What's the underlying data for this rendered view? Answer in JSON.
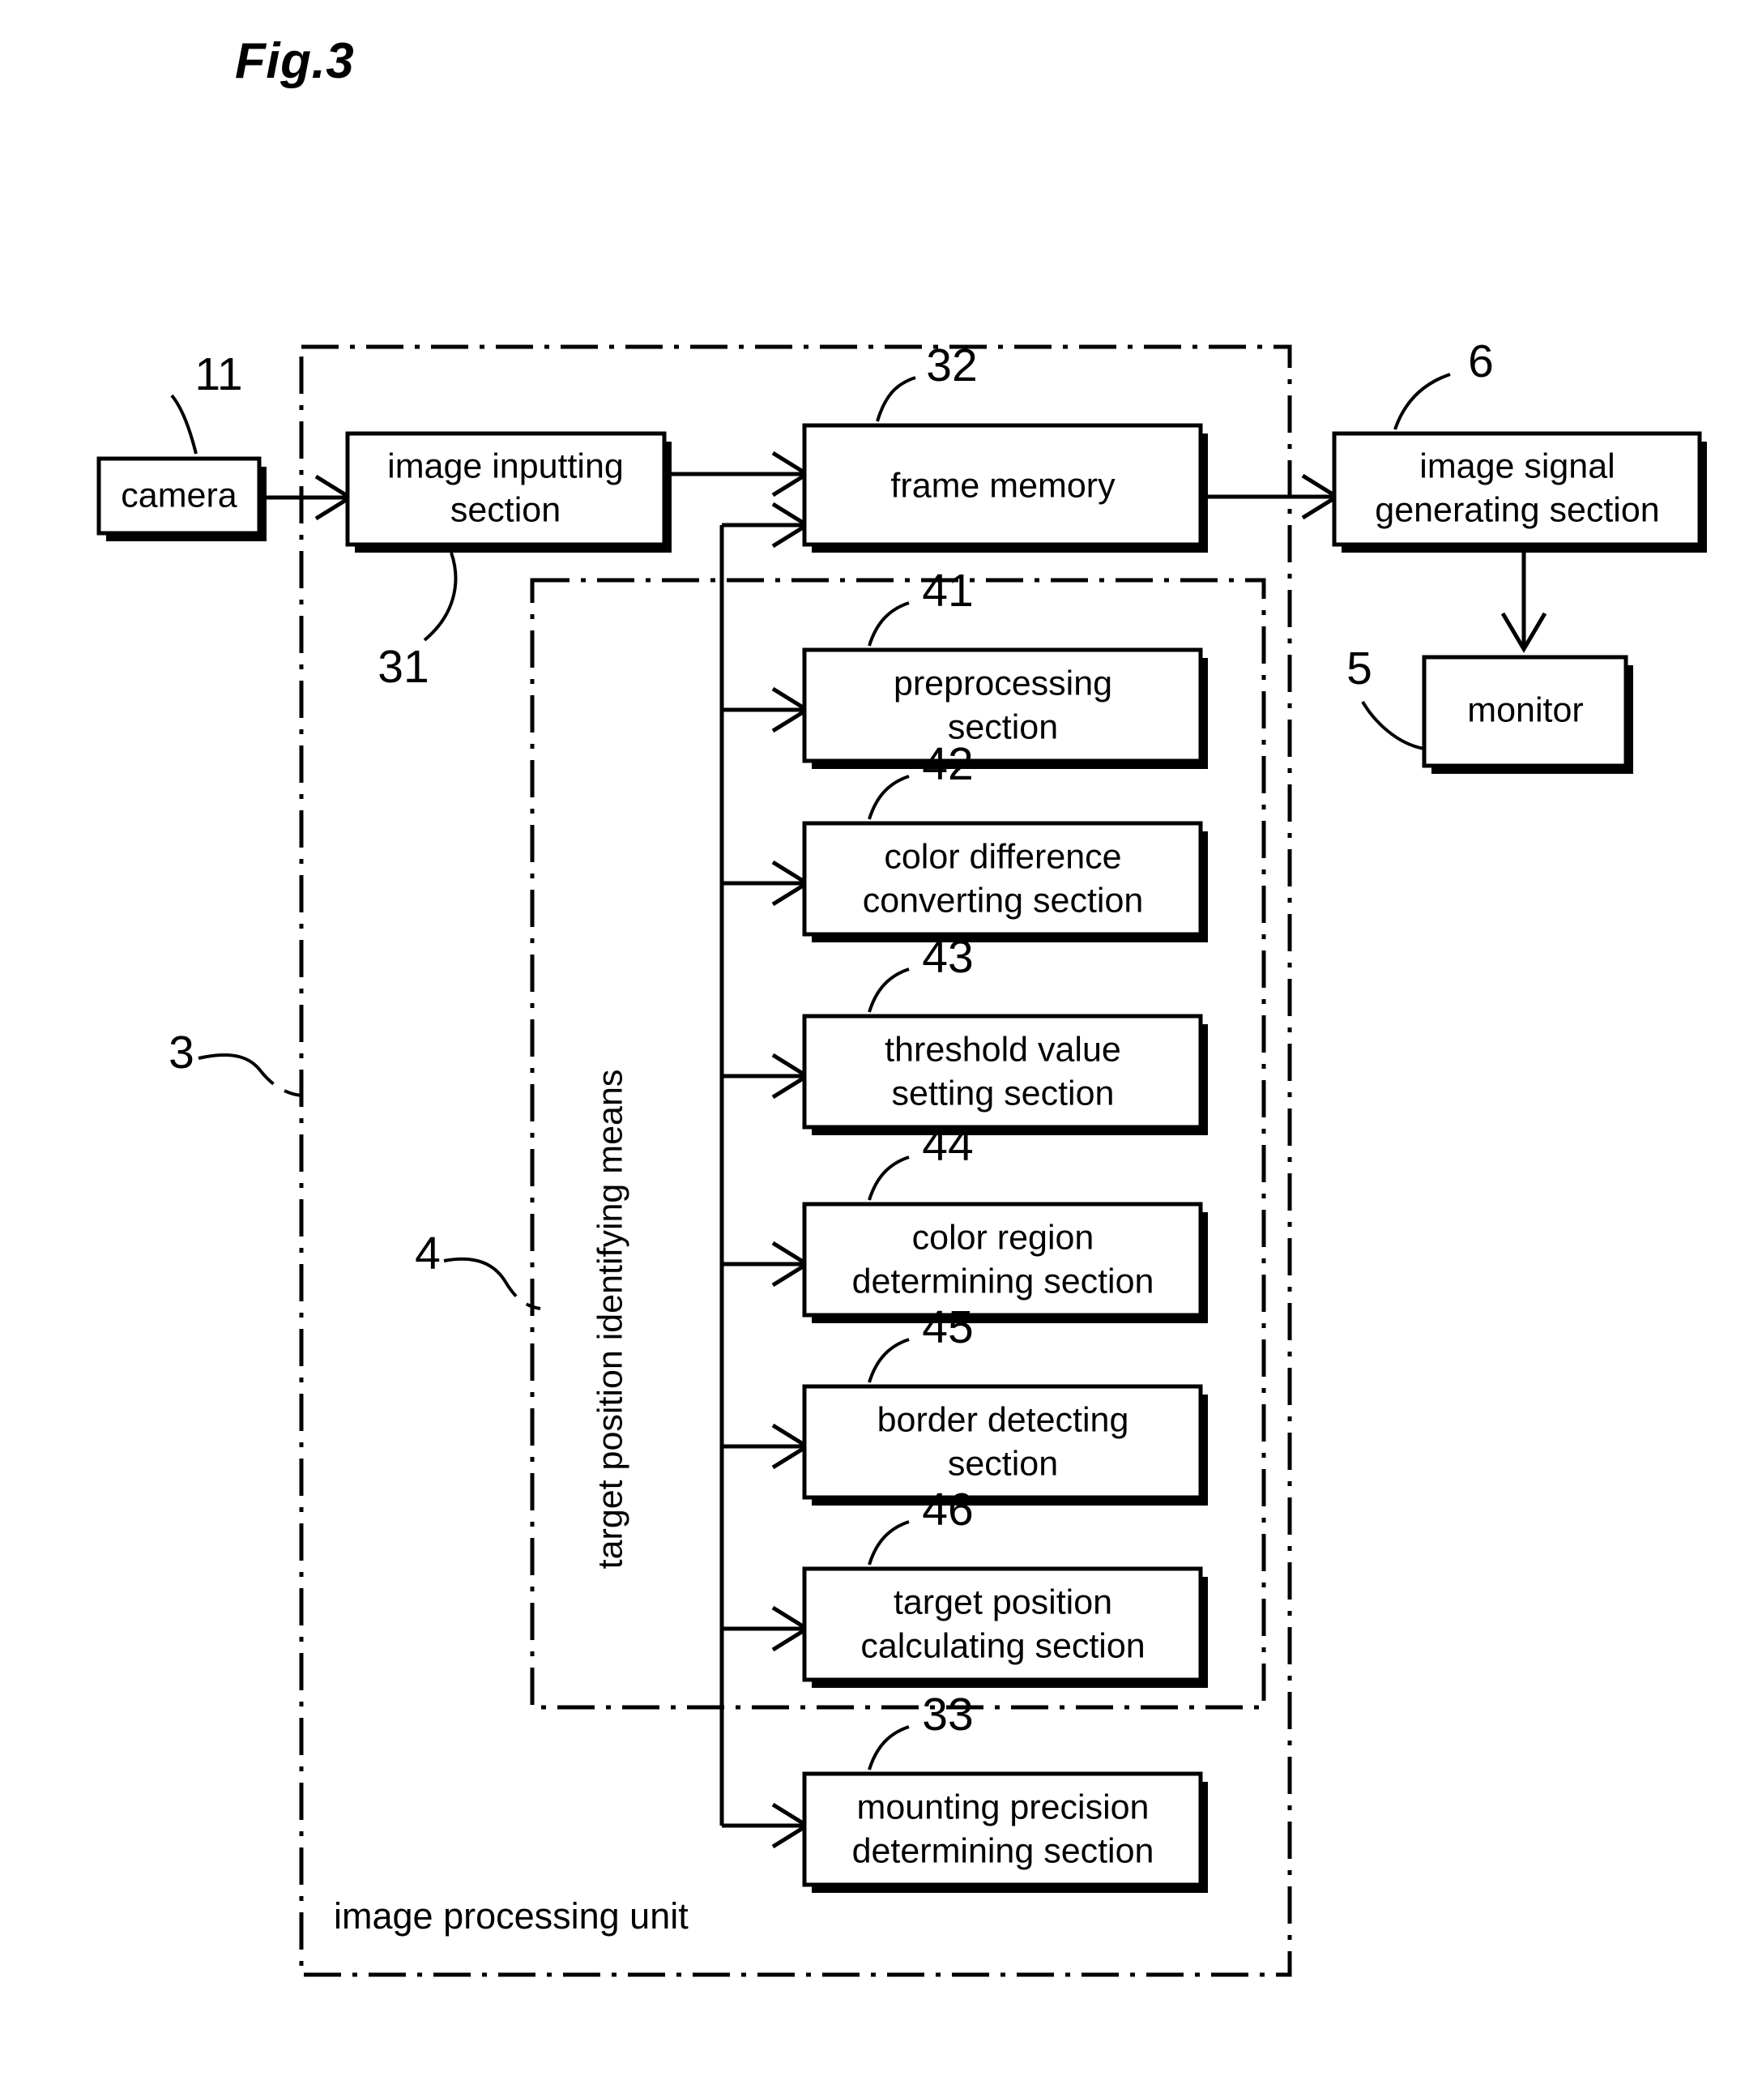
{
  "figure": {
    "title": "Fig.3",
    "type": "block-diagram",
    "outer_enclosure_label": "image processing unit",
    "outer_enclosure_ref": "3",
    "inner_enclosure_label": "target position identifying means",
    "inner_enclosure_ref": "4"
  },
  "blocks": {
    "camera": {
      "label": "camera",
      "ref": "11"
    },
    "image_inputting": {
      "label_line1": "image inputting",
      "label_line2": "section",
      "ref": "31"
    },
    "frame_memory": {
      "label": "frame memory",
      "ref": "32"
    },
    "image_signal_generating": {
      "label_line1": "image signal",
      "label_line2": "generating section",
      "ref": "6"
    },
    "monitor": {
      "label": "monitor",
      "ref": "5"
    },
    "preprocessing": {
      "label_line1": "preprocessing",
      "label_line2": "section",
      "ref": "41"
    },
    "color_difference": {
      "label_line1": "color difference",
      "label_line2": "converting section",
      "ref": "42"
    },
    "threshold_value": {
      "label_line1": "threshold value",
      "label_line2": "setting section",
      "ref": "43"
    },
    "color_region": {
      "label_line1": "color region",
      "label_line2": "determining section",
      "ref": "44"
    },
    "border_detecting": {
      "label_line1": "border detecting",
      "label_line2": "section",
      "ref": "45"
    },
    "target_position": {
      "label_line1": "target position",
      "label_line2": "calculating section",
      "ref": "46"
    },
    "mounting_precision": {
      "label_line1": "mounting precision",
      "label_line2": "determining section",
      "ref": "33"
    }
  },
  "colors": {
    "line": "#000000",
    "fill": "#ffffff",
    "text": "#000000"
  }
}
